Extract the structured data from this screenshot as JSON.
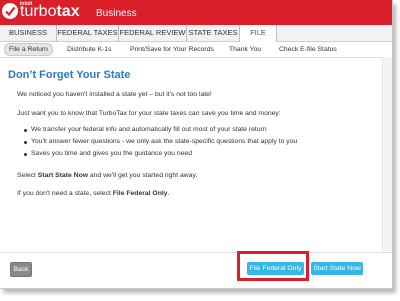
{
  "header": {
    "intuit_label": "intuit",
    "brand_prefix": "turbo",
    "brand_suffix": "tax",
    "edition": "Business"
  },
  "main_tabs": [
    {
      "label": "BUSINESS INFO"
    },
    {
      "label": "FEDERAL TAXES"
    },
    {
      "label": "FEDERAL REVIEW"
    },
    {
      "label": "STATE TAXES"
    },
    {
      "label": "FILE"
    }
  ],
  "sub_tabs": [
    {
      "label": "File a Return"
    },
    {
      "label": "Distribute K-1s"
    },
    {
      "label": "Print/Save for Your Records"
    },
    {
      "label": "Thank You"
    },
    {
      "label": "Check E-file Status"
    }
  ],
  "content": {
    "title": "Don’t Forget Your State",
    "intro": "We noticed you haven't installed a state yet – but it's not too late!",
    "lead": "Just want you to know that TurboTax for your state taxes can save you time and money:",
    "bullets": [
      "We transfer your federal info and automatically fill out most of your state return",
      "You'll answer fewer questions - we only ask the state-specific questions that apply to you",
      "Saves you time and gives you the guidance you need"
    ],
    "select_pre": "Select ",
    "select_bold": "Start State Now",
    "select_post": " and we'll get you started right away.",
    "nostate_pre": "If you don't need a state, select ",
    "nostate_bold": "File Federal Only",
    "nostate_post": "."
  },
  "footer": {
    "back_label": "Back",
    "federal_only_label": "File Federal Only",
    "start_state_label": "Start State Now"
  },
  "colors": {
    "brand_red": "#d81f2a",
    "title_blue": "#2b7bbf",
    "button_blue": "#35b7e8"
  }
}
